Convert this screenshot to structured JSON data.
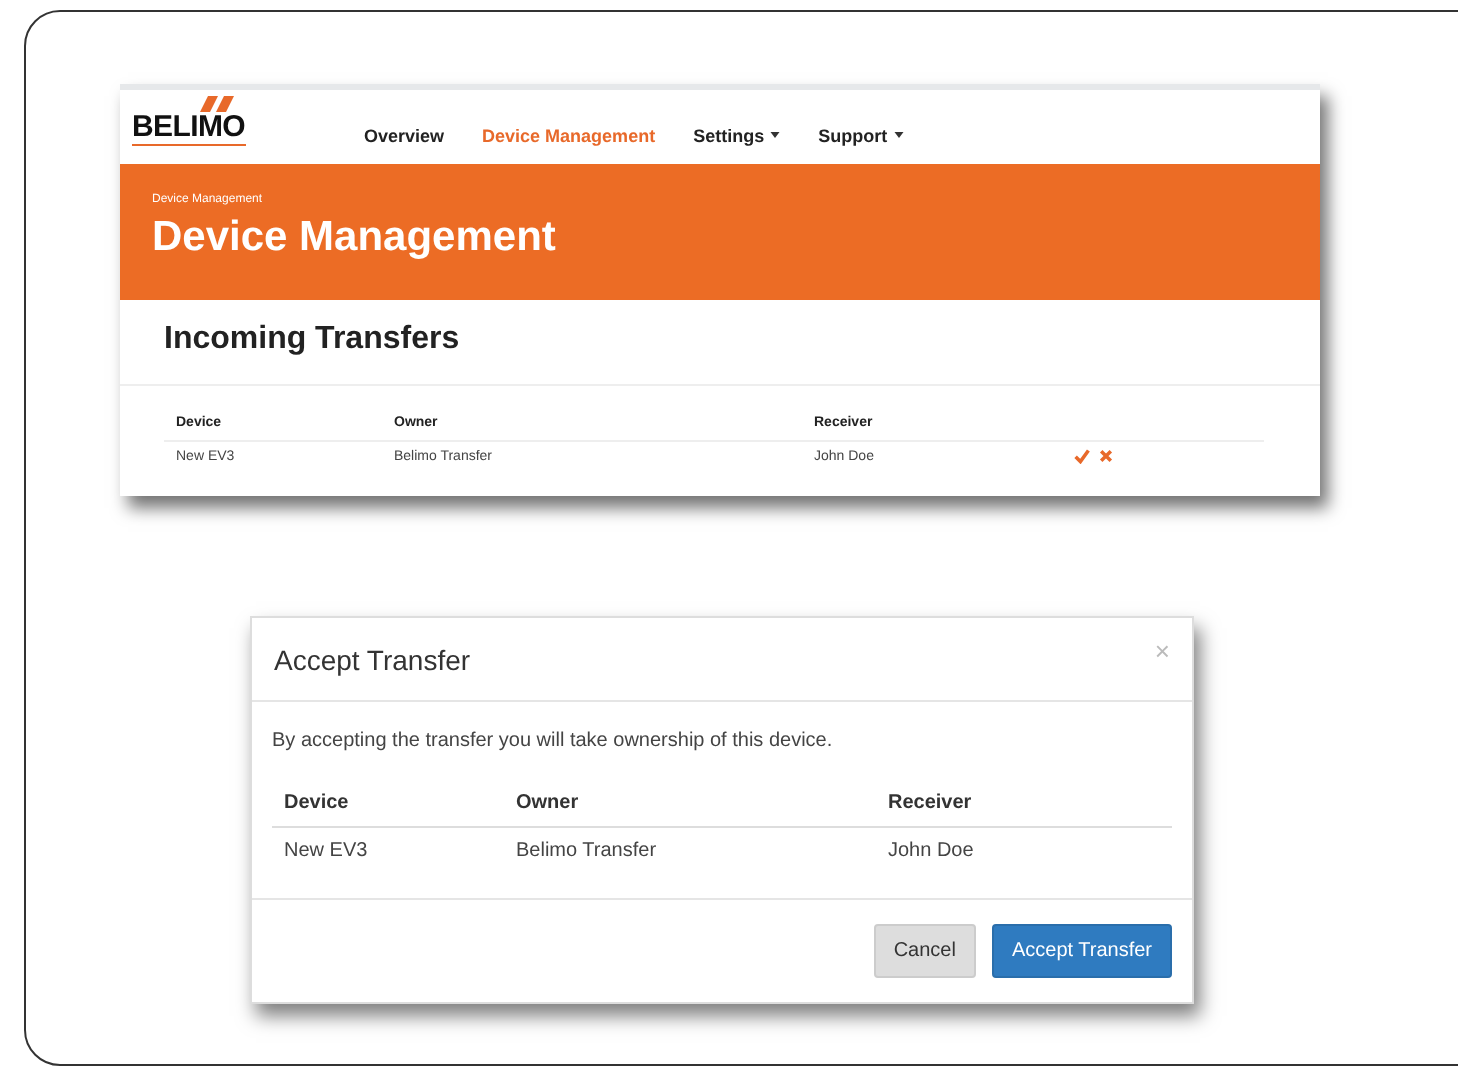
{
  "page_screenshot": {
    "logo": "BELIMO",
    "nav": [
      {
        "label": "Overview",
        "selected": false,
        "has_menu": false
      },
      {
        "label": "Device Management",
        "selected": true,
        "has_menu": false
      },
      {
        "label": "Settings",
        "selected": false,
        "has_menu": true
      },
      {
        "label": "Support",
        "selected": false,
        "has_menu": true
      }
    ],
    "breadcrumb": "Device Management",
    "title": "Device Management",
    "section_title": "Incoming Transfers",
    "table": {
      "columns": [
        "Device",
        "Owner",
        "Receiver"
      ],
      "rows": [
        {
          "cells": [
            "New EV3",
            "Belimo Transfer",
            "John Doe"
          ]
        }
      ]
    }
  },
  "dialog": {
    "title": "Accept Transfer",
    "close": "×",
    "message": "By accepting the transfer you will take ownership of this device.",
    "table": {
      "columns": [
        "Device",
        "Owner",
        "Receiver"
      ],
      "rows": [
        {
          "cells": [
            "New EV3",
            "Belimo Transfer",
            "John Doe"
          ]
        }
      ]
    },
    "buttons": [
      {
        "label": "Cancel",
        "kind": "secondary"
      },
      {
        "label": "Accept Transfer",
        "kind": "primary"
      }
    ]
  }
}
